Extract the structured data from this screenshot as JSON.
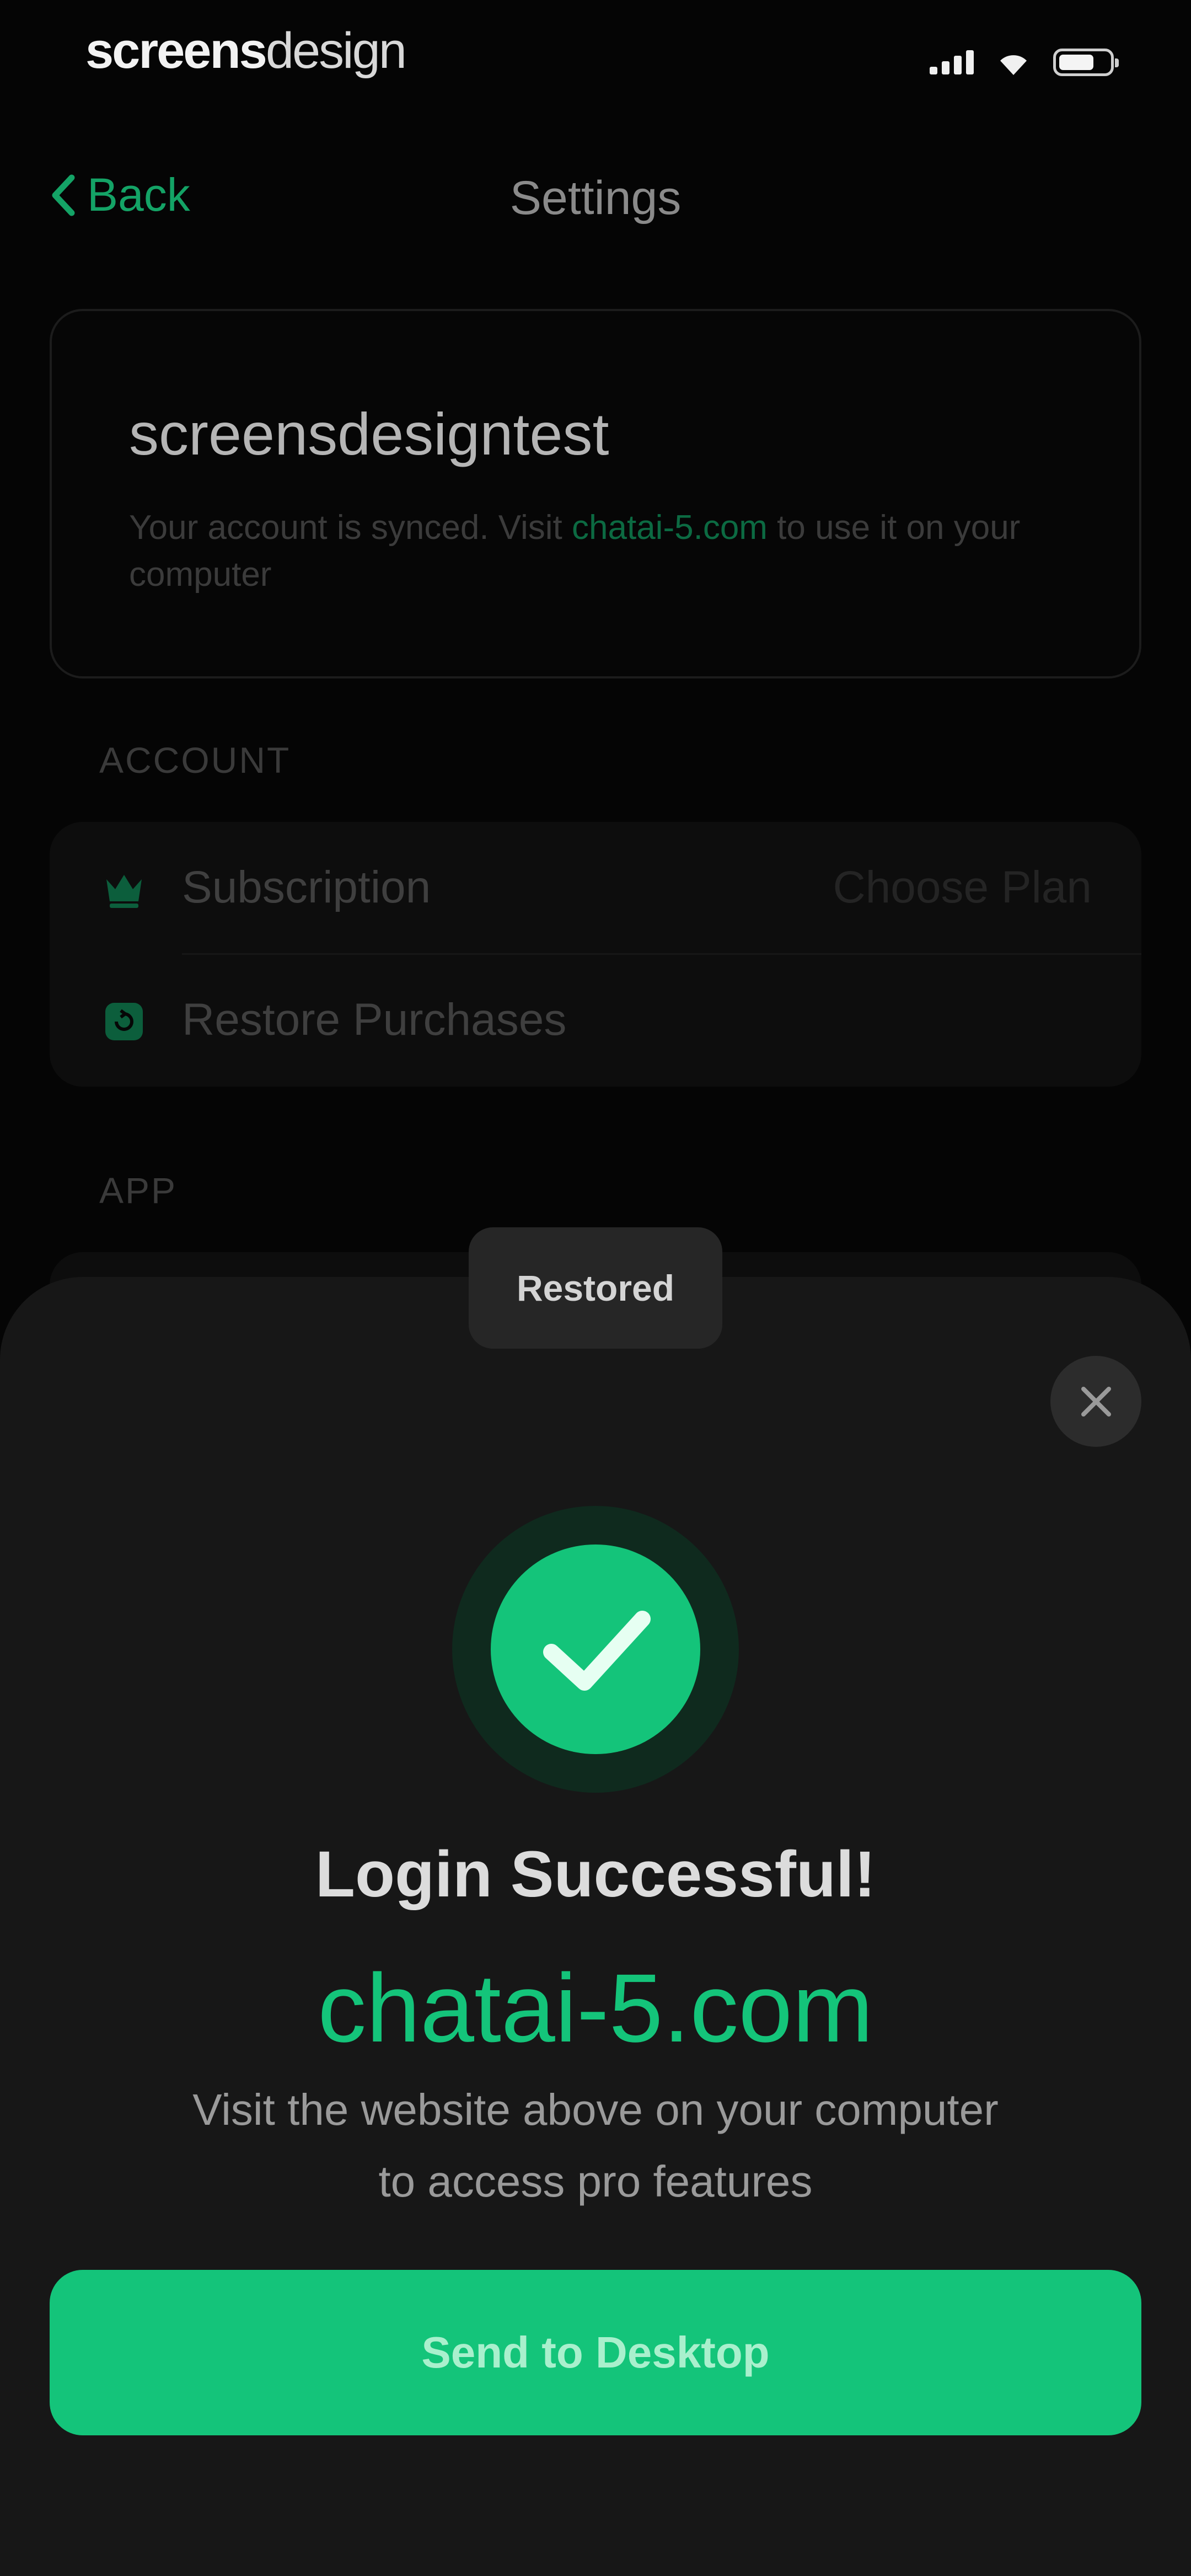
{
  "status_bar": {
    "brand_bold": "screens",
    "brand_light": "design",
    "battery_level": 0.7
  },
  "nav": {
    "back_label": "Back",
    "title": "Settings"
  },
  "account": {
    "username": "screensdesigntest",
    "description_before": "Your account is synced. Visit ",
    "description_link": "chatai-5.com",
    "description_after": " to use it on your computer"
  },
  "sections": {
    "account_label": "ACCOUNT",
    "app_label": "APP"
  },
  "account_rows": [
    {
      "label": "Subscription",
      "value": "Choose Plan",
      "icon": "crown-icon"
    },
    {
      "label": "Restore Purchases",
      "value": "",
      "icon": "restore-icon"
    }
  ],
  "toast": {
    "text": "Restored"
  },
  "sheet": {
    "title": "Login Successful!",
    "domain": "chatai-5.com",
    "description_line1": "Visit the website above on your computer",
    "description_line2": "to access pro features",
    "button_label": "Send to Desktop",
    "icon": "checkmark-icon"
  },
  "colors": {
    "accent": "#14c47a",
    "background": "#050505",
    "sheet": "#171717"
  }
}
